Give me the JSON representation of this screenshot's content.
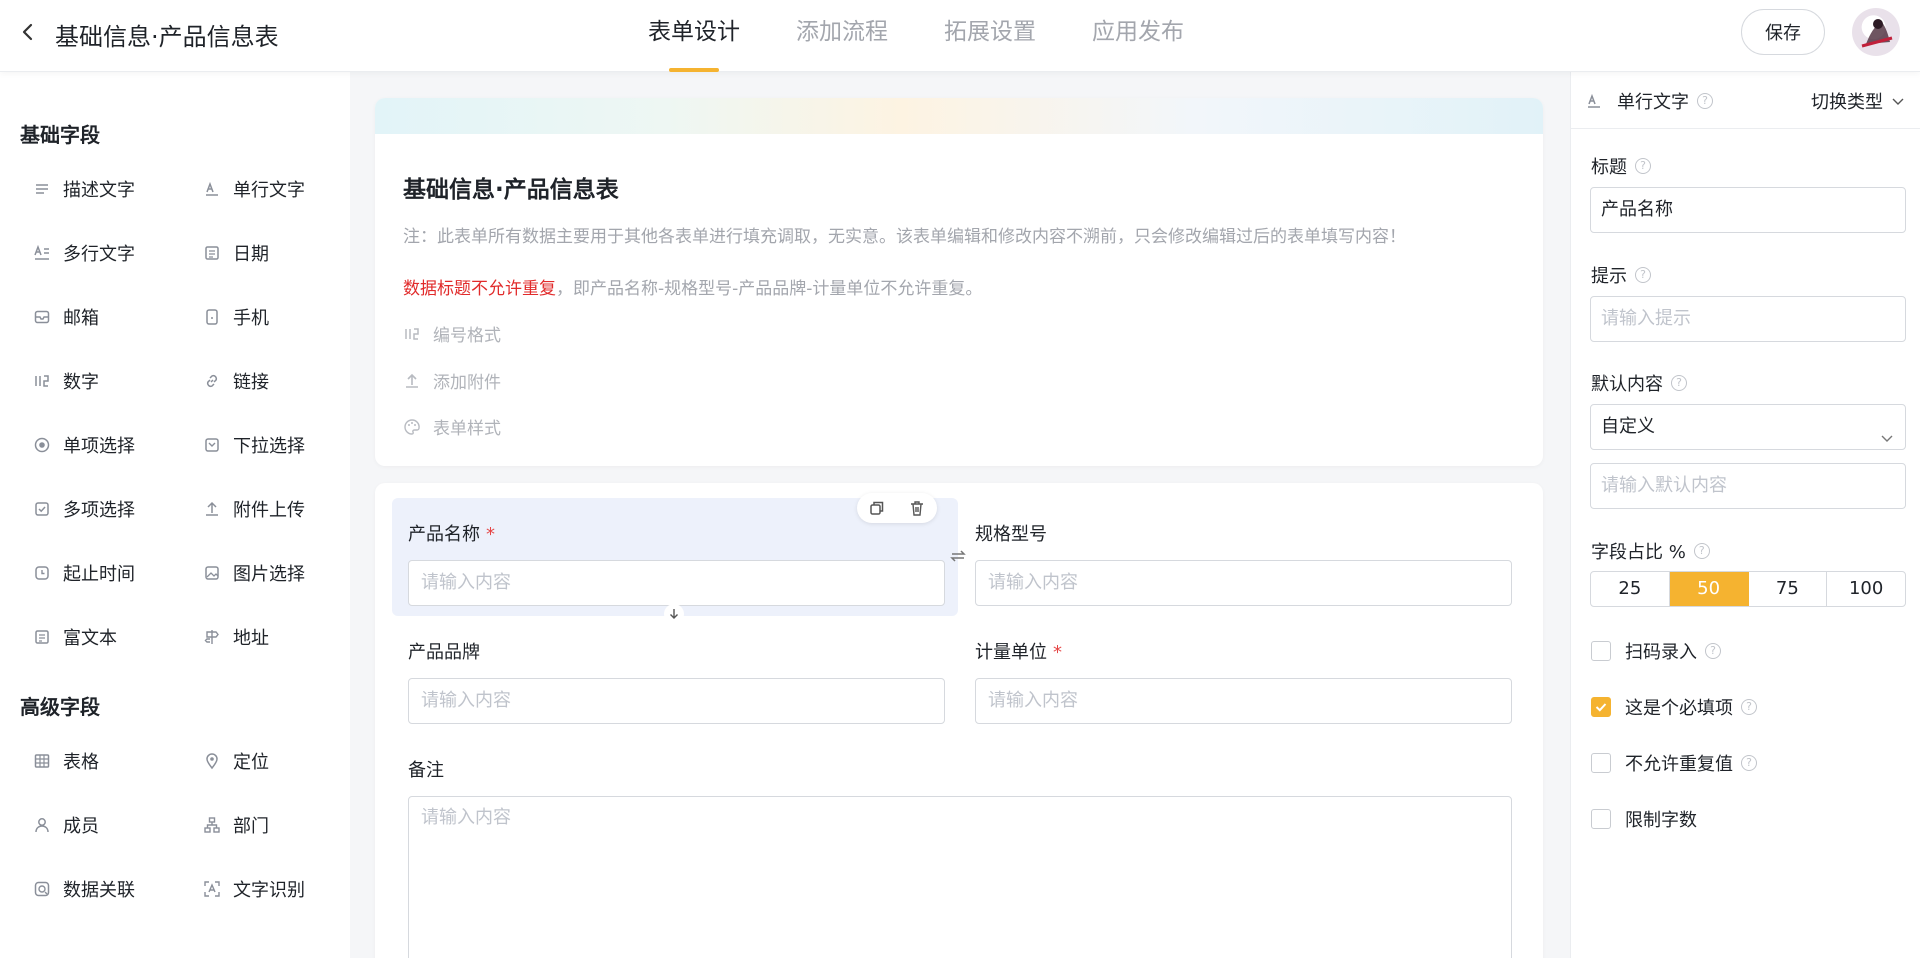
{
  "header": {
    "back_icon": "chevron-left-icon",
    "title": "基础信息·产品信息表",
    "tabs": [
      {
        "label": "表单设计",
        "active": true
      },
      {
        "label": "添加流程",
        "active": false
      },
      {
        "label": "拓展设置",
        "active": false
      },
      {
        "label": "应用发布",
        "active": false
      }
    ],
    "save_label": "保存",
    "accent": "#f5b330"
  },
  "left": {
    "basic_title": "基础字段",
    "basic": [
      {
        "label": "描述文字",
        "icon": "lines-icon"
      },
      {
        "label": "单行文字",
        "icon": "single-line-text-icon"
      },
      {
        "label": "多行文字",
        "icon": "multi-line-text-icon"
      },
      {
        "label": "日期",
        "icon": "calendar-icon"
      },
      {
        "label": "邮箱",
        "icon": "mail-icon"
      },
      {
        "label": "手机",
        "icon": "phone-icon"
      },
      {
        "label": "数字",
        "icon": "number-icon"
      },
      {
        "label": "链接",
        "icon": "link-icon"
      },
      {
        "label": "单项选择",
        "icon": "radio-icon"
      },
      {
        "label": "下拉选择",
        "icon": "dropdown-icon"
      },
      {
        "label": "多项选择",
        "icon": "checkbox-icon"
      },
      {
        "label": "附件上传",
        "icon": "upload-icon"
      },
      {
        "label": "起止时间",
        "icon": "time-range-icon"
      },
      {
        "label": "图片选择",
        "icon": "image-icon"
      },
      {
        "label": "富文本",
        "icon": "rich-text-icon"
      },
      {
        "label": "地址",
        "icon": "address-icon"
      }
    ],
    "advanced_title": "高级字段",
    "advanced": [
      {
        "label": "表格",
        "icon": "table-icon"
      },
      {
        "label": "定位",
        "icon": "location-pin-icon"
      },
      {
        "label": "成员",
        "icon": "user-icon"
      },
      {
        "label": "部门",
        "icon": "org-chart-icon"
      },
      {
        "label": "数据关联",
        "icon": "data-link-icon"
      },
      {
        "label": "文字识别",
        "icon": "ocr-scan-icon"
      }
    ]
  },
  "form": {
    "title": "基础信息·产品信息表",
    "note": "注：此表单所有数据主要用于其他各表单进行填充调取，无实意。该表单编辑和修改内容不溯前，只会修改编辑过后的表单填写内容！",
    "note2_red": "数据标题不允许重复",
    "note2_rest": "，即产品名称-规格型号-产品品牌-计量单位不允许重复。",
    "options": [
      {
        "label": "编号格式",
        "icon": "number-format-icon"
      },
      {
        "label": "添加附件",
        "icon": "upload-icon"
      },
      {
        "label": "表单样式",
        "icon": "palette-icon"
      }
    ],
    "fields": [
      {
        "label": "产品名称",
        "required": true,
        "placeholder": "请输入内容"
      },
      {
        "label": "规格型号",
        "required": false,
        "placeholder": "请输入内容"
      },
      {
        "label": "产品品牌",
        "required": false,
        "placeholder": "请输入内容"
      },
      {
        "label": "计量单位",
        "required": true,
        "placeholder": "请输入内容"
      },
      {
        "label": "备注",
        "required": false,
        "placeholder": "请输入内容"
      }
    ],
    "required_mark": "*"
  },
  "props": {
    "type_label": "单行文字",
    "switch_label": "切换类型",
    "title_label": "标题",
    "title_value": "产品名称",
    "hint_label": "提示",
    "hint_placeholder": "请输入提示",
    "default_label": "默认内容",
    "default_select": "自定义",
    "default_placeholder": "请输入默认内容",
    "ratio_label": "字段占比 %",
    "ratio_options": [
      "25",
      "50",
      "75",
      "100"
    ],
    "ratio_selected": "50",
    "help_glyph": "?",
    "checks": [
      {
        "label": "扫码录入",
        "checked": false,
        "help": true
      },
      {
        "label": "这是个必填项",
        "checked": true,
        "help": true
      },
      {
        "label": "不允许重复值",
        "checked": false,
        "help": true
      },
      {
        "label": "限制字数",
        "checked": false,
        "help": false
      }
    ]
  }
}
